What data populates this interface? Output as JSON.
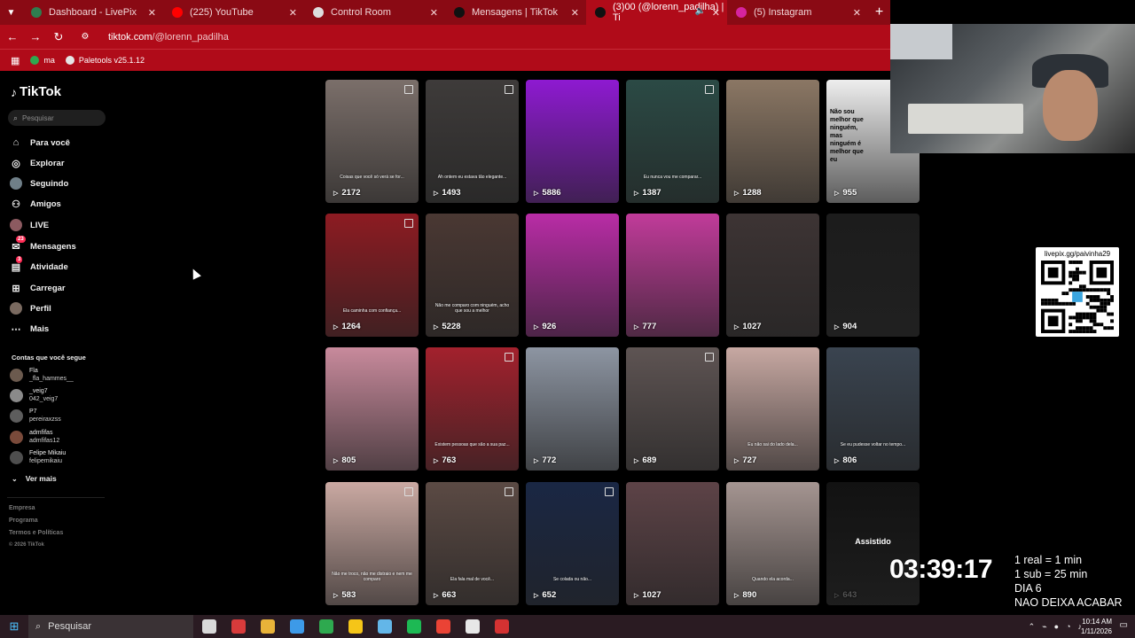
{
  "browser": {
    "tabs": [
      {
        "label": "Dashboard - LivePix",
        "color": "#2f7d4f"
      },
      {
        "label": "(225) YouTube",
        "color": "#ff0000"
      },
      {
        "label": "Control Room",
        "color": "#dddddd"
      },
      {
        "label": "Mensagens | TikTok",
        "color": "#111111"
      },
      {
        "label": "(3)00 (@lorenn_padilha) | Ti",
        "color": "#111111",
        "active": true
      },
      {
        "label": "(5) Instagram",
        "color": "#d6249f"
      }
    ],
    "url_host": "tiktok.com",
    "url_path": "/@lorenn_padilha",
    "bookmarks": [
      {
        "label": "ma",
        "color": "#2fa84f"
      },
      {
        "label": "Paletools v25.1.12",
        "color": "#e5e5e5"
      }
    ]
  },
  "tiktok": {
    "logo": "TikTok",
    "search_placeholder": "Pesquisar",
    "nav": [
      {
        "label": "Para você",
        "icon": "home-icon"
      },
      {
        "label": "Explorar",
        "icon": "compass-icon"
      },
      {
        "label": "Seguindo",
        "icon": "following-avatar"
      },
      {
        "label": "Amigos",
        "icon": "friends-icon"
      },
      {
        "label": "LIVE",
        "icon": "live-avatar"
      },
      {
        "label": "Mensagens",
        "icon": "messages-icon",
        "badge": "23"
      },
      {
        "label": "Atividade",
        "icon": "activity-icon",
        "badge": "3"
      },
      {
        "label": "Carregar",
        "icon": "upload-icon"
      },
      {
        "label": "Perfil",
        "icon": "profile-avatar"
      },
      {
        "label": "Mais",
        "icon": "more-icon"
      }
    ],
    "following_title": "Contas que você segue",
    "following": [
      {
        "name": "Fla",
        "user": "_fla_hammes__",
        "color": "#6b5a4e"
      },
      {
        "name": "_veig7",
        "user": "042_veig7",
        "color": "#8a8a8a"
      },
      {
        "name": "P7",
        "user": "pereiraxzss",
        "color": "#5d5d5d"
      },
      {
        "name": "admfifas",
        "user": "admfifas12",
        "color": "#7a4a3a"
      },
      {
        "name": "Felipe Mikaiu",
        "user": "felipemikaiu",
        "color": "#4e4e4e"
      }
    ],
    "see_more": "Ver mais",
    "footer": [
      "Empresa",
      "Programa",
      "Termos e Políticas",
      "© 2026 TikTok"
    ]
  },
  "videos": [
    {
      "views": "2172",
      "bg": "#7b6f6a",
      "pin": true,
      "cap": "Coisas que você só verá se for..."
    },
    {
      "views": "1493",
      "bg": "#3e3b3a",
      "pin": true,
      "cap": "Ah ontem eu estava tão elegante..."
    },
    {
      "views": "5886",
      "bg": "#8e1ad1",
      "pin": false,
      "cap": ""
    },
    {
      "views": "1387",
      "bg": "#2b4a45",
      "pin": true,
      "cap": "Eu nunca vou me comparar..."
    },
    {
      "views": "1288",
      "bg": "#8b7764",
      "pin": false,
      "cap": ""
    },
    {
      "views": "955",
      "bg": "#eeeeee",
      "pin": false,
      "cap": "",
      "text": "Não sou melhor que ninguém, mas ninguém é melhor que eu"
    },
    {
      "views": "1264",
      "bg": "#8d1b22",
      "pin": true,
      "cap": "Ela caminha com confiança..."
    },
    {
      "views": "5228",
      "bg": "#4a3833",
      "pin": false,
      "cap": "Não me comparo com ninguém, acho que sou a melhor"
    },
    {
      "views": "926",
      "bg": "#b92ca6",
      "pin": false,
      "cap": ""
    },
    {
      "views": "777",
      "bg": "#c13b9a",
      "pin": false,
      "cap": ""
    },
    {
      "views": "1027",
      "bg": "#3d3434",
      "pin": false,
      "cap": ""
    },
    {
      "views": "904",
      "bg": "#1c1c1c",
      "pin": false,
      "cap": ""
    },
    {
      "views": "805",
      "bg": "#c88a9c",
      "pin": false,
      "cap": ""
    },
    {
      "views": "763",
      "bg": "#a3212d",
      "pin": true,
      "cap": "Existem pessoas que são a sua paz..."
    },
    {
      "views": "772",
      "bg": "#8d95a2",
      "pin": false,
      "cap": ""
    },
    {
      "views": "689",
      "bg": "#5e5453",
      "pin": true,
      "cap": ""
    },
    {
      "views": "727",
      "bg": "#c7a8a2",
      "pin": false,
      "cap": "Eu não sai do lado dela..."
    },
    {
      "views": "806",
      "bg": "#3a4450",
      "pin": false,
      "cap": "Se eu pudesse voltar no tempo..."
    },
    {
      "views": "583",
      "bg": "#caa9a2",
      "pin": true,
      "cap": "Não me troco, não me distraio e nem me comparo"
    },
    {
      "views": "663",
      "bg": "#5b4a44",
      "pin": true,
      "cap": "Ela fala mal de você..."
    },
    {
      "views": "652",
      "bg": "#1a2744",
      "pin": true,
      "cap": "Se colada ou não..."
    },
    {
      "views": "1027",
      "bg": "#5d4347",
      "pin": false,
      "cap": ""
    },
    {
      "views": "890",
      "bg": "#a59591",
      "pin": false,
      "cap": "Quando ela acorda..."
    },
    {
      "views": "643",
      "bg": "#121212",
      "pin": false,
      "cap": "",
      "watched": "Assistido",
      "dimmed": true
    }
  ],
  "overlay": {
    "qr_label": "livepix.gg/paivinha29",
    "timer": "03:39:17",
    "lines": [
      "1 real = 1 min",
      "1 sub = 25 min",
      "DIA 6",
      "NAO DEIXA ACABAR"
    ]
  },
  "taskbar": {
    "search": "Pesquisar",
    "time": "10:14 AM",
    "date": "1/11/2026",
    "apps": [
      "#d9d9d9",
      "#d83b3b",
      "#e8b339",
      "#3d9ae8",
      "#2ea94f",
      "#f5c518",
      "#63b6e8",
      "#1db954",
      "#ea4335",
      "#e7e7e7",
      "#d43232"
    ]
  }
}
